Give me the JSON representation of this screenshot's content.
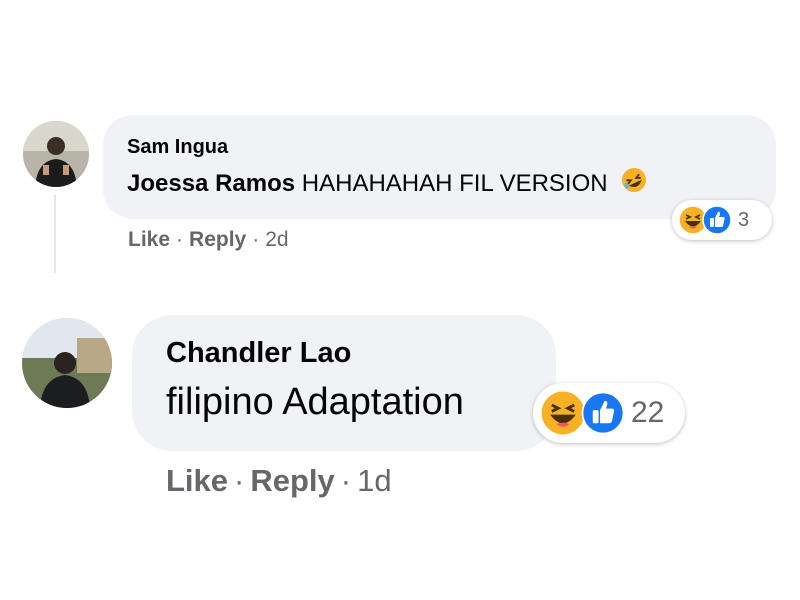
{
  "comments": [
    {
      "author": "Sam Ingua",
      "mention": "Joessa Ramos",
      "text": "HAHAHAHAH FIL VERSION",
      "inline_emoji": "rolling-on-floor-laughing-icon",
      "reactions": {
        "icons": [
          "haha-icon",
          "like-icon"
        ],
        "count": "3"
      },
      "actions": {
        "like": "Like",
        "reply": "Reply",
        "separator": "·",
        "time": "2d"
      }
    },
    {
      "author": "Chandler Lao",
      "text": "filipino Adaptation",
      "reactions": {
        "icons": [
          "haha-icon",
          "like-icon"
        ],
        "count": "22"
      },
      "actions": {
        "like": "Like",
        "reply": "Reply",
        "separator": "·",
        "time": "1d"
      }
    }
  ],
  "colors": {
    "bubble": "#f0f2f5",
    "text": "#050505",
    "muted": "#65676b",
    "like_blue": "#1877f2",
    "haha_yellow": "#f7b125"
  }
}
